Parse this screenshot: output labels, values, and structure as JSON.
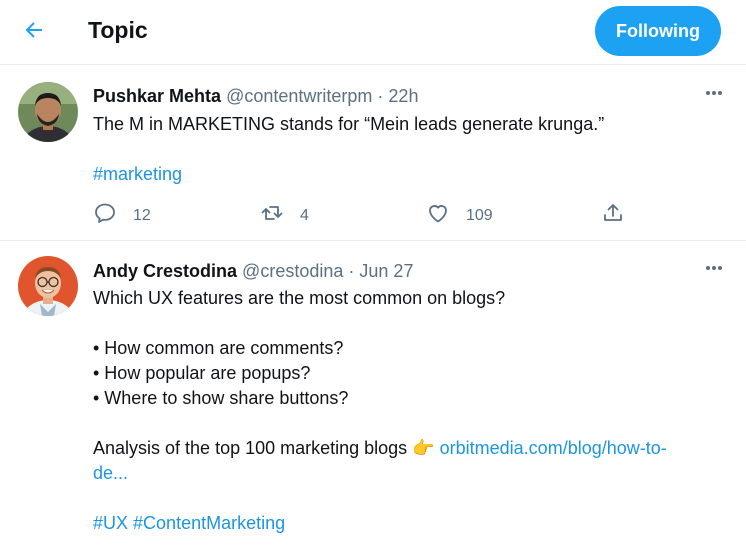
{
  "header": {
    "title": "Topic",
    "follow_label": "Following"
  },
  "colors": {
    "accent": "#1da1f2",
    "link": "#1b95e0",
    "muted": "#5b7083"
  },
  "tweets": [
    {
      "name": "Pushkar Mehta",
      "handle": "@contentwriterpm",
      "sep": "·",
      "time": "22h",
      "text": "The M in MARKETING stands for “Mein leads generate krunga.”",
      "hashtag": "#marketing",
      "replies": "12",
      "retweets": "4",
      "likes": "109"
    },
    {
      "name": "Andy Crestodina",
      "handle": "@crestodina",
      "sep": "·",
      "time": "Jun 27",
      "line1": "Which UX features are the most common on blogs?",
      "bullet1": "• How common are comments?",
      "bullet2": "• How popular are popups?",
      "bullet3": "• Where to show share buttons?",
      "analysis_text": "Analysis of the top 100 marketing blogs",
      "emoji": "👉",
      "link_part1": "orbitmedia.com/blog/how-to-",
      "link_part2": "de...",
      "hashtag1": "#UX",
      "hashtag2": "#ContentMarketing"
    }
  ],
  "icons": {
    "back": "arrow-left-icon",
    "more": "more-horizontal-icon",
    "reply": "reply-icon",
    "retweet": "retweet-icon",
    "like": "heart-icon",
    "share": "share-icon"
  }
}
